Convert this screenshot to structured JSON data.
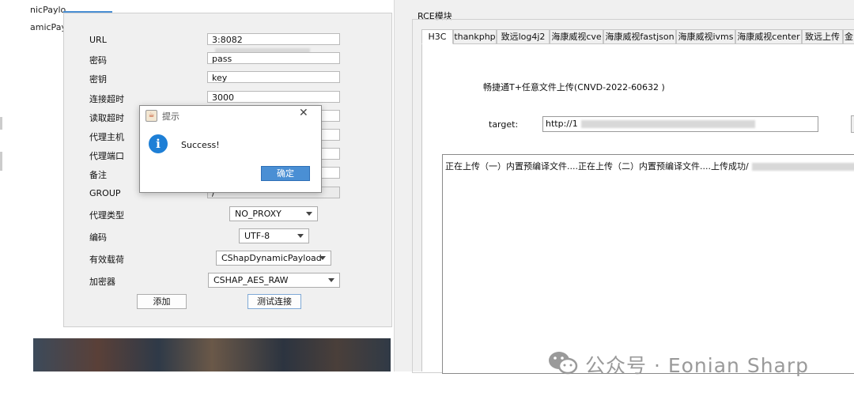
{
  "background": {
    "left_text_1": "nicPaylo",
    "left_text_2": "amicPaylo"
  },
  "config_form": {
    "fields": [
      {
        "label": "URL",
        "value": "3:8082"
      },
      {
        "label": "密码",
        "value": "pass"
      },
      {
        "label": "密钥",
        "value": "key"
      },
      {
        "label": "连接超时",
        "value": "3000"
      },
      {
        "label": "读取超时",
        "value": ""
      },
      {
        "label": "代理主机",
        "value": ""
      },
      {
        "label": "代理端口",
        "value": ""
      },
      {
        "label": "备注",
        "value": ""
      },
      {
        "label": "GROUP",
        "value": "/"
      }
    ],
    "proxy_type_label": "代理类型",
    "proxy_type_value": "NO_PROXY",
    "encoding_label": "编码",
    "encoding_value": "UTF-8",
    "payload_label": "有效载荷",
    "payload_value": "CShapDynamicPayload",
    "encryptor_label": "加密器",
    "encryptor_value": "CSHAP_AES_RAW",
    "add_button": "添加",
    "test_button": "测试连接"
  },
  "modal": {
    "title": "提示",
    "close_glyph": "✕",
    "icon_glyph": "i",
    "message": "Success!",
    "ok_button": "确定"
  },
  "rce_panel": {
    "title": "RCE模块",
    "tabs": [
      "H3C",
      "thankphp",
      "致远log4j2",
      "海康威视cve",
      "海康威视fastjson",
      "海康威视ivms",
      "海康威视center",
      "致远上传",
      "金"
    ],
    "active_tab_index": 0,
    "vuln_title": "畅捷通T+任意文件上传(CNVD-2022-60632 )",
    "target_label": "target:",
    "target_value": "http://1",
    "output_text": "正在上传（一）内置预编译文件....正在上传（二）内置预编译文件....上传成功/"
  },
  "watermark": {
    "text": "公众号 · Eonian Sharp",
    "icon": "wechat-icon",
    "color": "#9a9a9a"
  },
  "colors": {
    "accent": "#4a8fd4",
    "info_icon": "#1e7fd6"
  }
}
